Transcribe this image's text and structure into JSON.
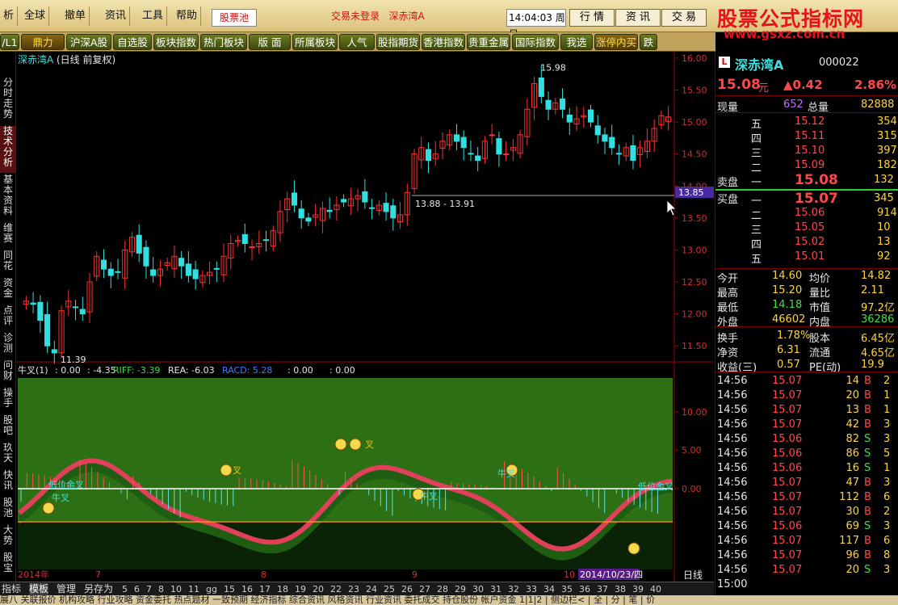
{
  "menu": {
    "item0": "析",
    "item1": "全球",
    "item2": "撤单",
    "item3": "资讯",
    "item4": "工具",
    "item5": "帮助",
    "active_tab": "股票池",
    "status": "交易未登录",
    "status_stock": "深赤湾A",
    "clock": "14:04:03",
    "weekday": "周日",
    "btn_market": "行 情",
    "btn_news": "资 讯",
    "btn_trade": "交 易"
  },
  "logo": {
    "title": "股票公式指标网",
    "url": "www.gsxz.com.cn"
  },
  "categories": [
    "/L1",
    "鼎力",
    "沪深A股",
    "自选股",
    "板块指数",
    "热门板块",
    "版 面",
    "所属板块",
    "人气",
    "股指期货",
    "香港指数",
    "贵重金属",
    "国际指数",
    "我选",
    "涨停内买",
    "跌停"
  ],
  "left_tabs": [
    "分时走势",
    "技术分析",
    "基本资料",
    "维赛",
    "同花",
    "资金",
    "点评",
    "诊测",
    "问财",
    "操手",
    "股吧",
    "玖天",
    "快讯",
    "股池",
    "大势",
    "股宝"
  ],
  "chart": {
    "title": "深赤湾A",
    "period": "(日线 前复权)",
    "hi_label": "15.98",
    "lo_label": "11.39",
    "range_label": "13.88 - 13.91",
    "price_tag": "13.85",
    "ind_name": "牛叉(1)",
    "ind_v1": ": 0.00",
    "ind_v2": ": -4.35",
    "riff": "RIFF: -3.39",
    "rea": "REA: -6.03",
    "racd": "RACD: 5.28",
    "ind_v3": ": 0.00",
    "ind_v4": ": 0.00",
    "y_ticks": [
      "16.00",
      "15.50",
      "15.00",
      "14.50",
      "14.00",
      "13.50",
      "13.00",
      "12.50",
      "12.00",
      "11.50"
    ],
    "ind_ticks": [
      "10.00",
      "5.00",
      "0.00"
    ],
    "x_labels": [
      "2014年",
      "7",
      "8",
      "9",
      "10"
    ],
    "date_tag": "2014/10/23/四",
    "period_label": "日线",
    "annot_golden": "低位金叉",
    "annot_cross": "牛叉",
    "annot_cross_b": "叉"
  },
  "chart_data": {
    "type": "candlestick",
    "ylim": [
      11.3,
      16.1
    ],
    "hi": 15.98,
    "lo": 11.39,
    "last_close": 15.08,
    "closes": [
      12.2,
      12.15,
      11.9,
      11.5,
      11.39,
      12.05,
      12.2,
      12.1,
      12.0,
      12.5,
      12.9,
      12.7,
      12.6,
      12.65,
      13.0,
      13.2,
      12.95,
      12.75,
      12.6,
      12.7,
      12.8,
      12.9,
      12.75,
      12.6,
      12.55,
      12.6,
      12.65,
      12.7,
      12.9,
      13.1,
      13.15,
      13.1,
      13.05,
      13.1,
      13.15,
      13.3,
      13.6,
      13.8,
      13.7,
      13.5,
      13.45,
      13.55,
      13.65,
      13.6,
      13.7,
      13.75,
      13.8,
      13.85,
      13.75,
      13.65,
      13.7,
      13.6,
      13.5,
      13.55,
      13.9,
      14.5,
      14.6,
      14.4,
      14.5,
      14.7,
      14.8,
      14.7,
      14.6,
      14.5,
      14.4,
      14.7,
      14.8,
      14.5,
      14.5,
      14.6,
      14.8,
      15.2,
      15.6,
      15.4,
      15.2,
      15.3,
      15.2,
      15.0,
      15.05,
      15.1,
      15.0,
      14.8,
      14.7,
      14.6,
      14.5,
      14.6,
      14.4,
      14.6,
      14.7,
      14.9,
      15.1,
      15.08
    ]
  },
  "right": {
    "name": "深赤湾A",
    "code": "000022",
    "price": "15.08",
    "price_unit": "元",
    "change": "▲0.42",
    "pct": "2.86%",
    "now_vol_label": "现量",
    "now_vol": "652",
    "total_label": "总量",
    "total": "82888",
    "sell_label": "卖盘",
    "buy_label": "买盘",
    "asks": [
      {
        "l": "五",
        "p": "15.12",
        "v": "354"
      },
      {
        "l": "四",
        "p": "15.11",
        "v": "315"
      },
      {
        "l": "三",
        "p": "15.10",
        "v": "397"
      },
      {
        "l": "二",
        "p": "15.09",
        "v": "182"
      },
      {
        "l": "一",
        "p": "15.08",
        "v": "132"
      }
    ],
    "bids": [
      {
        "l": "一",
        "p": "15.07",
        "v": "345"
      },
      {
        "l": "二",
        "p": "15.06",
        "v": "914"
      },
      {
        "l": "三",
        "p": "15.05",
        "v": "10"
      },
      {
        "l": "四",
        "p": "15.02",
        "v": "13"
      },
      {
        "l": "五",
        "p": "15.01",
        "v": "92"
      }
    ],
    "stats": [
      [
        "今开",
        "14.60",
        "均价",
        "14.82"
      ],
      [
        "最高",
        "15.20",
        "量比",
        "2.11"
      ],
      [
        "最低",
        "14.18",
        "市值",
        "97.2亿"
      ],
      [
        "外盘",
        "46602",
        "内盘",
        "36286"
      ]
    ],
    "stats2": [
      [
        "换手",
        "1.78%",
        "股本",
        "6.45亿"
      ],
      [
        "净资",
        "6.31",
        "流通",
        "4.65亿"
      ],
      [
        "收益(三)",
        "0.57",
        "PE(动)",
        "19.9"
      ]
    ],
    "ticks": [
      [
        "14:56",
        "15.07",
        "14",
        "B",
        "2"
      ],
      [
        "14:56",
        "15.07",
        "20",
        "B",
        "1"
      ],
      [
        "14:56",
        "15.07",
        "13",
        "B",
        "1"
      ],
      [
        "14:56",
        "15.07",
        "42",
        "B",
        "3"
      ],
      [
        "14:56",
        "15.06",
        "82",
        "S",
        "3"
      ],
      [
        "14:56",
        "15.06",
        "86",
        "S",
        "5"
      ],
      [
        "14:56",
        "15.06",
        "16",
        "S",
        "1"
      ],
      [
        "14:56",
        "15.07",
        "47",
        "B",
        "3"
      ],
      [
        "14:56",
        "15.07",
        "112",
        "B",
        "6"
      ],
      [
        "14:56",
        "15.07",
        "30",
        "B",
        "2"
      ],
      [
        "14:56",
        "15.06",
        "69",
        "S",
        "3"
      ],
      [
        "14:56",
        "15.07",
        "117",
        "B",
        "6"
      ],
      [
        "14:56",
        "15.07",
        "96",
        "B",
        "8"
      ],
      [
        "14:56",
        "15.07",
        "20",
        "S",
        "3"
      ],
      [
        "15:00",
        "",
        "",
        "",
        ""
      ]
    ]
  },
  "bottom": {
    "tabs": [
      "指标",
      "模板",
      "管理",
      "另存为"
    ],
    "nums": [
      "5",
      "6",
      "7",
      "8",
      "10",
      "11",
      "gg",
      "15",
      "16",
      "17",
      "18",
      "19",
      "20",
      "22",
      "23",
      "24",
      "25",
      "26",
      "27",
      "28",
      "29",
      "30",
      "31",
      "32",
      "33",
      "34",
      "35",
      "36",
      "37",
      "38",
      "39",
      "40"
    ],
    "row2": "展八 关联报价 机构攻略 行业攻略 资金委托 热点题材 一致预期 经济指标 综合资讯 风格资讯 行业资讯 委托成交 持仓股份 帐户资金 1|1|2 | 侧边栏< | 全 | 分 | 笔 | 价"
  }
}
